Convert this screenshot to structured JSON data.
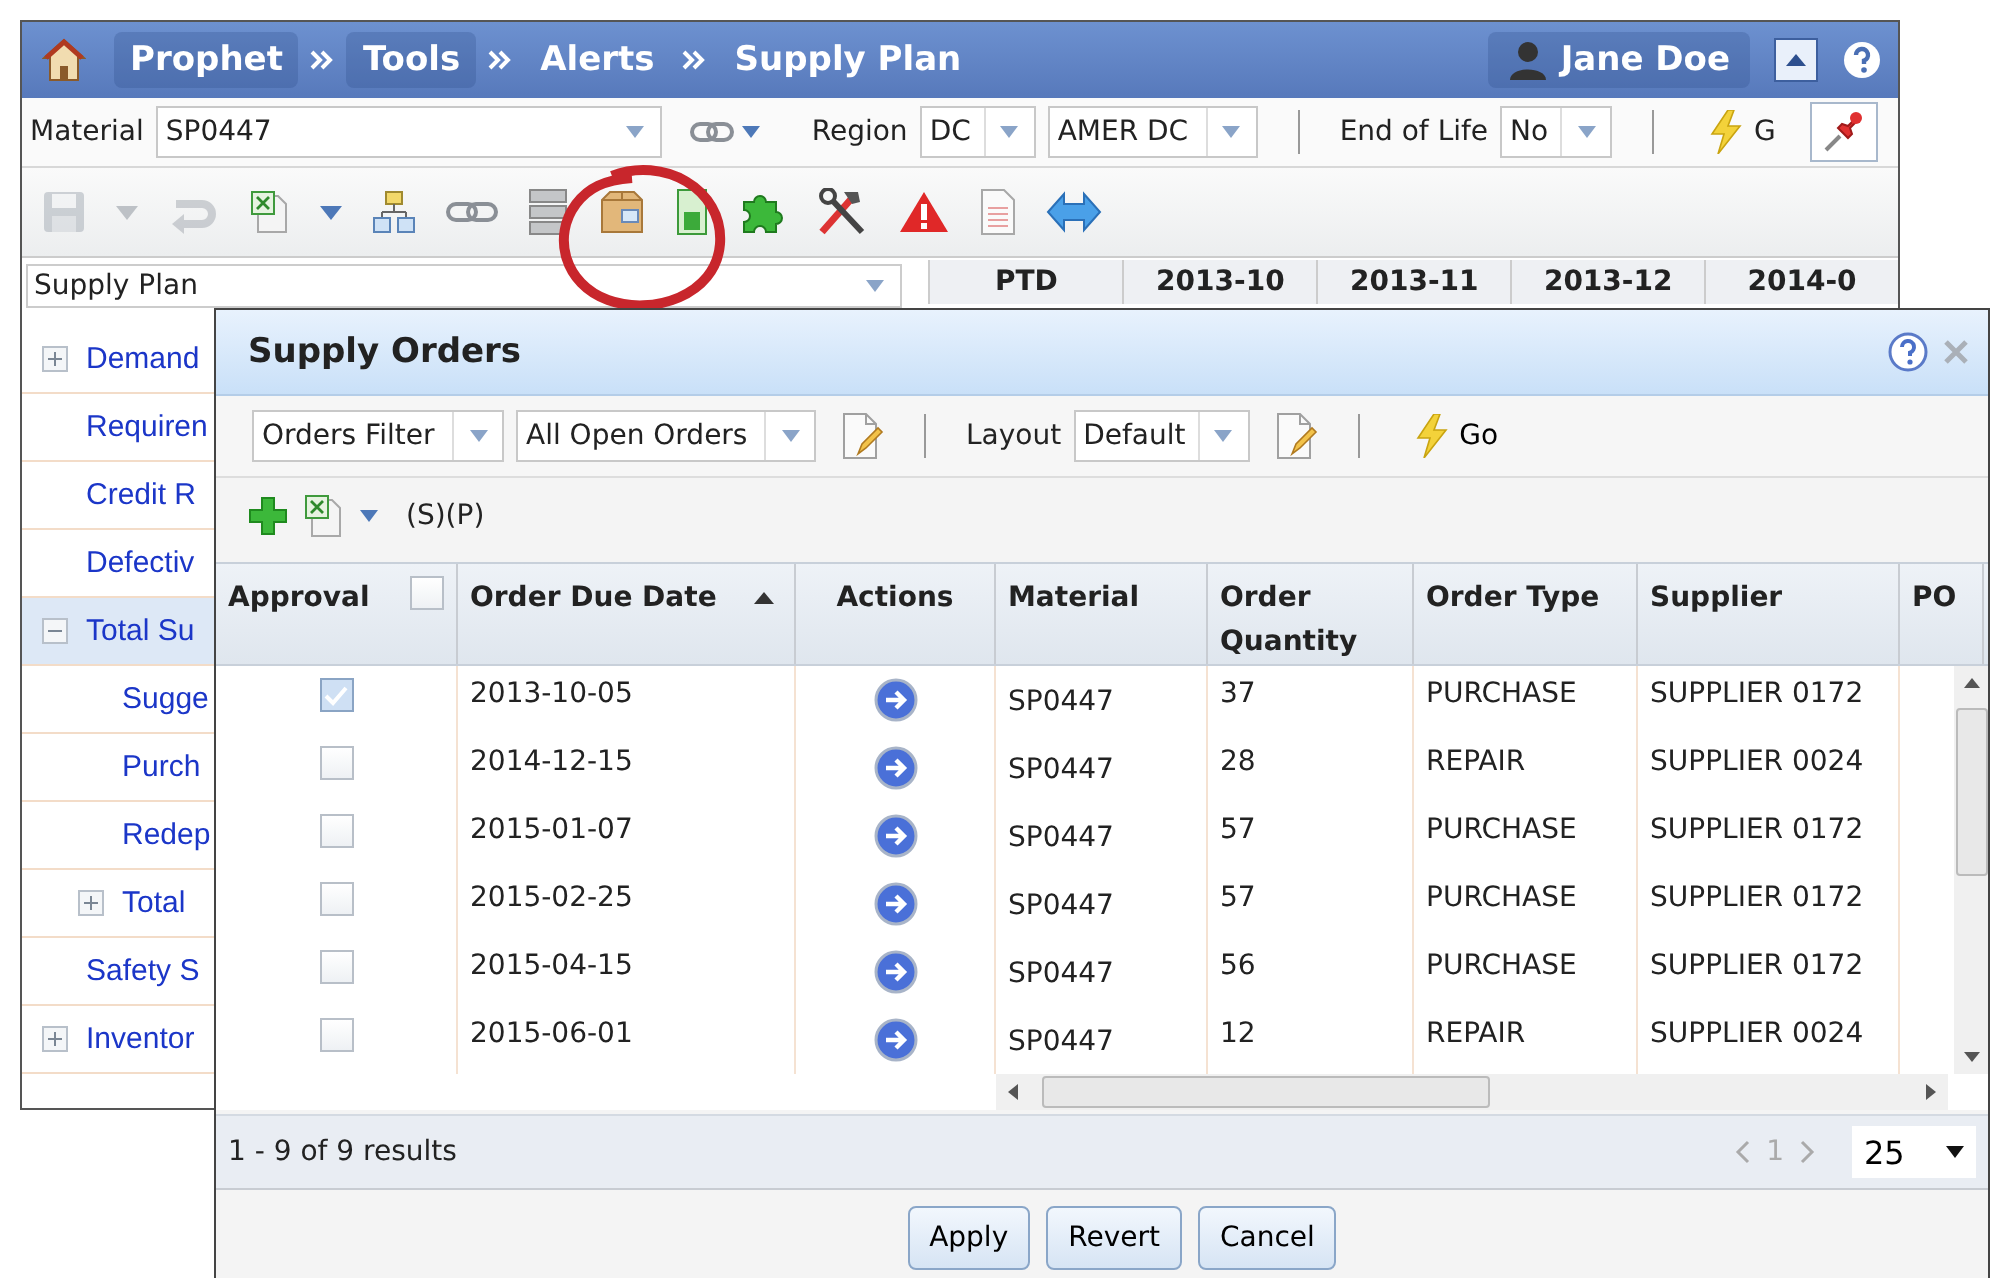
{
  "breadcrumbs": [
    {
      "label": "Prophet"
    },
    {
      "label": "Tools"
    },
    {
      "label": "Alerts"
    },
    {
      "label": "Supply Plan"
    }
  ],
  "user": "Jane Doe",
  "filters": {
    "material_label": "Material",
    "material": "SP0447",
    "region_label": "Region",
    "region": "DC",
    "region_name": "AMER DC",
    "end_of_life_label": "End of Life",
    "end_of_life": "No",
    "go": "G"
  },
  "toolbar": [
    {
      "kind": "save",
      "disabled": true
    },
    {
      "kind": "caret",
      "disabled": true
    },
    {
      "kind": "undo",
      "disabled": true
    },
    {
      "kind": "excel",
      "disabled": false
    },
    {
      "kind": "caret",
      "disabled": false
    },
    {
      "kind": "hierarchy",
      "disabled": false
    },
    {
      "kind": "link",
      "disabled": false
    },
    {
      "kind": "server",
      "disabled": false
    },
    {
      "kind": "box",
      "disabled": false
    },
    {
      "kind": "sheet",
      "disabled": false
    },
    {
      "kind": "puzzle",
      "disabled": false
    },
    {
      "kind": "tools",
      "disabled": false
    },
    {
      "kind": "warning",
      "disabled": false
    },
    {
      "kind": "page",
      "disabled": false
    },
    {
      "kind": "arrows",
      "disabled": false
    }
  ],
  "plan_select": "Supply Plan",
  "period_columns": [
    "PTD",
    "2013-10",
    "2013-11",
    "2013-12",
    "2014-0"
  ],
  "tree": {
    "items": [
      {
        "label": "Demand",
        "kind": "group",
        "expanded": false,
        "selected": false
      },
      {
        "label": "Requiren",
        "kind": "leaf",
        "selected": false
      },
      {
        "label": "Credit R",
        "kind": "leaf",
        "selected": false
      },
      {
        "label": "Defectiv",
        "kind": "leaf",
        "selected": false
      },
      {
        "label": "Total Su",
        "kind": "group",
        "expanded": true,
        "selected": true,
        "children": [
          {
            "label": "Sugge",
            "kind": "leaf",
            "selected": false
          },
          {
            "label": "Purch",
            "kind": "leaf",
            "selected": false
          },
          {
            "label": "Redep",
            "kind": "leaf",
            "selected": false
          },
          {
            "label": "Total",
            "kind": "group",
            "expanded": false,
            "selected": false
          }
        ]
      },
      {
        "label": "Safety S",
        "kind": "leaf",
        "selected": false
      },
      {
        "label": "Inventor",
        "kind": "group",
        "expanded": false,
        "selected": false
      }
    ]
  },
  "dialog": {
    "title": "Supply Orders",
    "orders_filter": "Orders Filter",
    "view": "All Open Orders",
    "layout_label": "Layout",
    "layout": "Default",
    "go": "Go",
    "view_code": "(S)(P)",
    "approve_all": false,
    "columns": [
      {
        "label": "Approval",
        "sorted": false
      },
      {
        "label": "Order Due Date",
        "sorted": true
      },
      {
        "label": "Actions",
        "sorted": false
      },
      {
        "label": "Material",
        "sorted": false
      },
      {
        "label": "Order Quantity",
        "sorted": false
      },
      {
        "label": "Order Type",
        "sorted": false
      },
      {
        "label": "Supplier",
        "sorted": false
      },
      {
        "label": "PO",
        "sorted": false
      }
    ],
    "rows": [
      {
        "approved": true,
        "due": "2013-10-05",
        "material": "SP0447",
        "quantity": "37",
        "type": "PURCHASE",
        "supplier": "SUPPLIER 0172"
      },
      {
        "approved": false,
        "due": "2014-12-15",
        "material": "SP0447",
        "quantity": "28",
        "type": "REPAIR",
        "supplier": "SUPPLIER 0024"
      },
      {
        "approved": false,
        "due": "2015-01-07",
        "material": "SP0447",
        "quantity": "57",
        "type": "PURCHASE",
        "supplier": "SUPPLIER 0172"
      },
      {
        "approved": false,
        "due": "2015-02-25",
        "material": "SP0447",
        "quantity": "57",
        "type": "PURCHASE",
        "supplier": "SUPPLIER 0172"
      },
      {
        "approved": false,
        "due": "2015-04-15",
        "material": "SP0447",
        "quantity": "56",
        "type": "PURCHASE",
        "supplier": "SUPPLIER 0172"
      },
      {
        "approved": false,
        "due": "2015-06-01",
        "material": "SP0447",
        "quantity": "12",
        "type": "REPAIR",
        "supplier": "SUPPLIER 0024"
      }
    ],
    "results": "1 - 9 of 9 results",
    "page": "1",
    "page_size": "25",
    "buttons": [
      "Apply",
      "Revert",
      "Cancel"
    ]
  }
}
